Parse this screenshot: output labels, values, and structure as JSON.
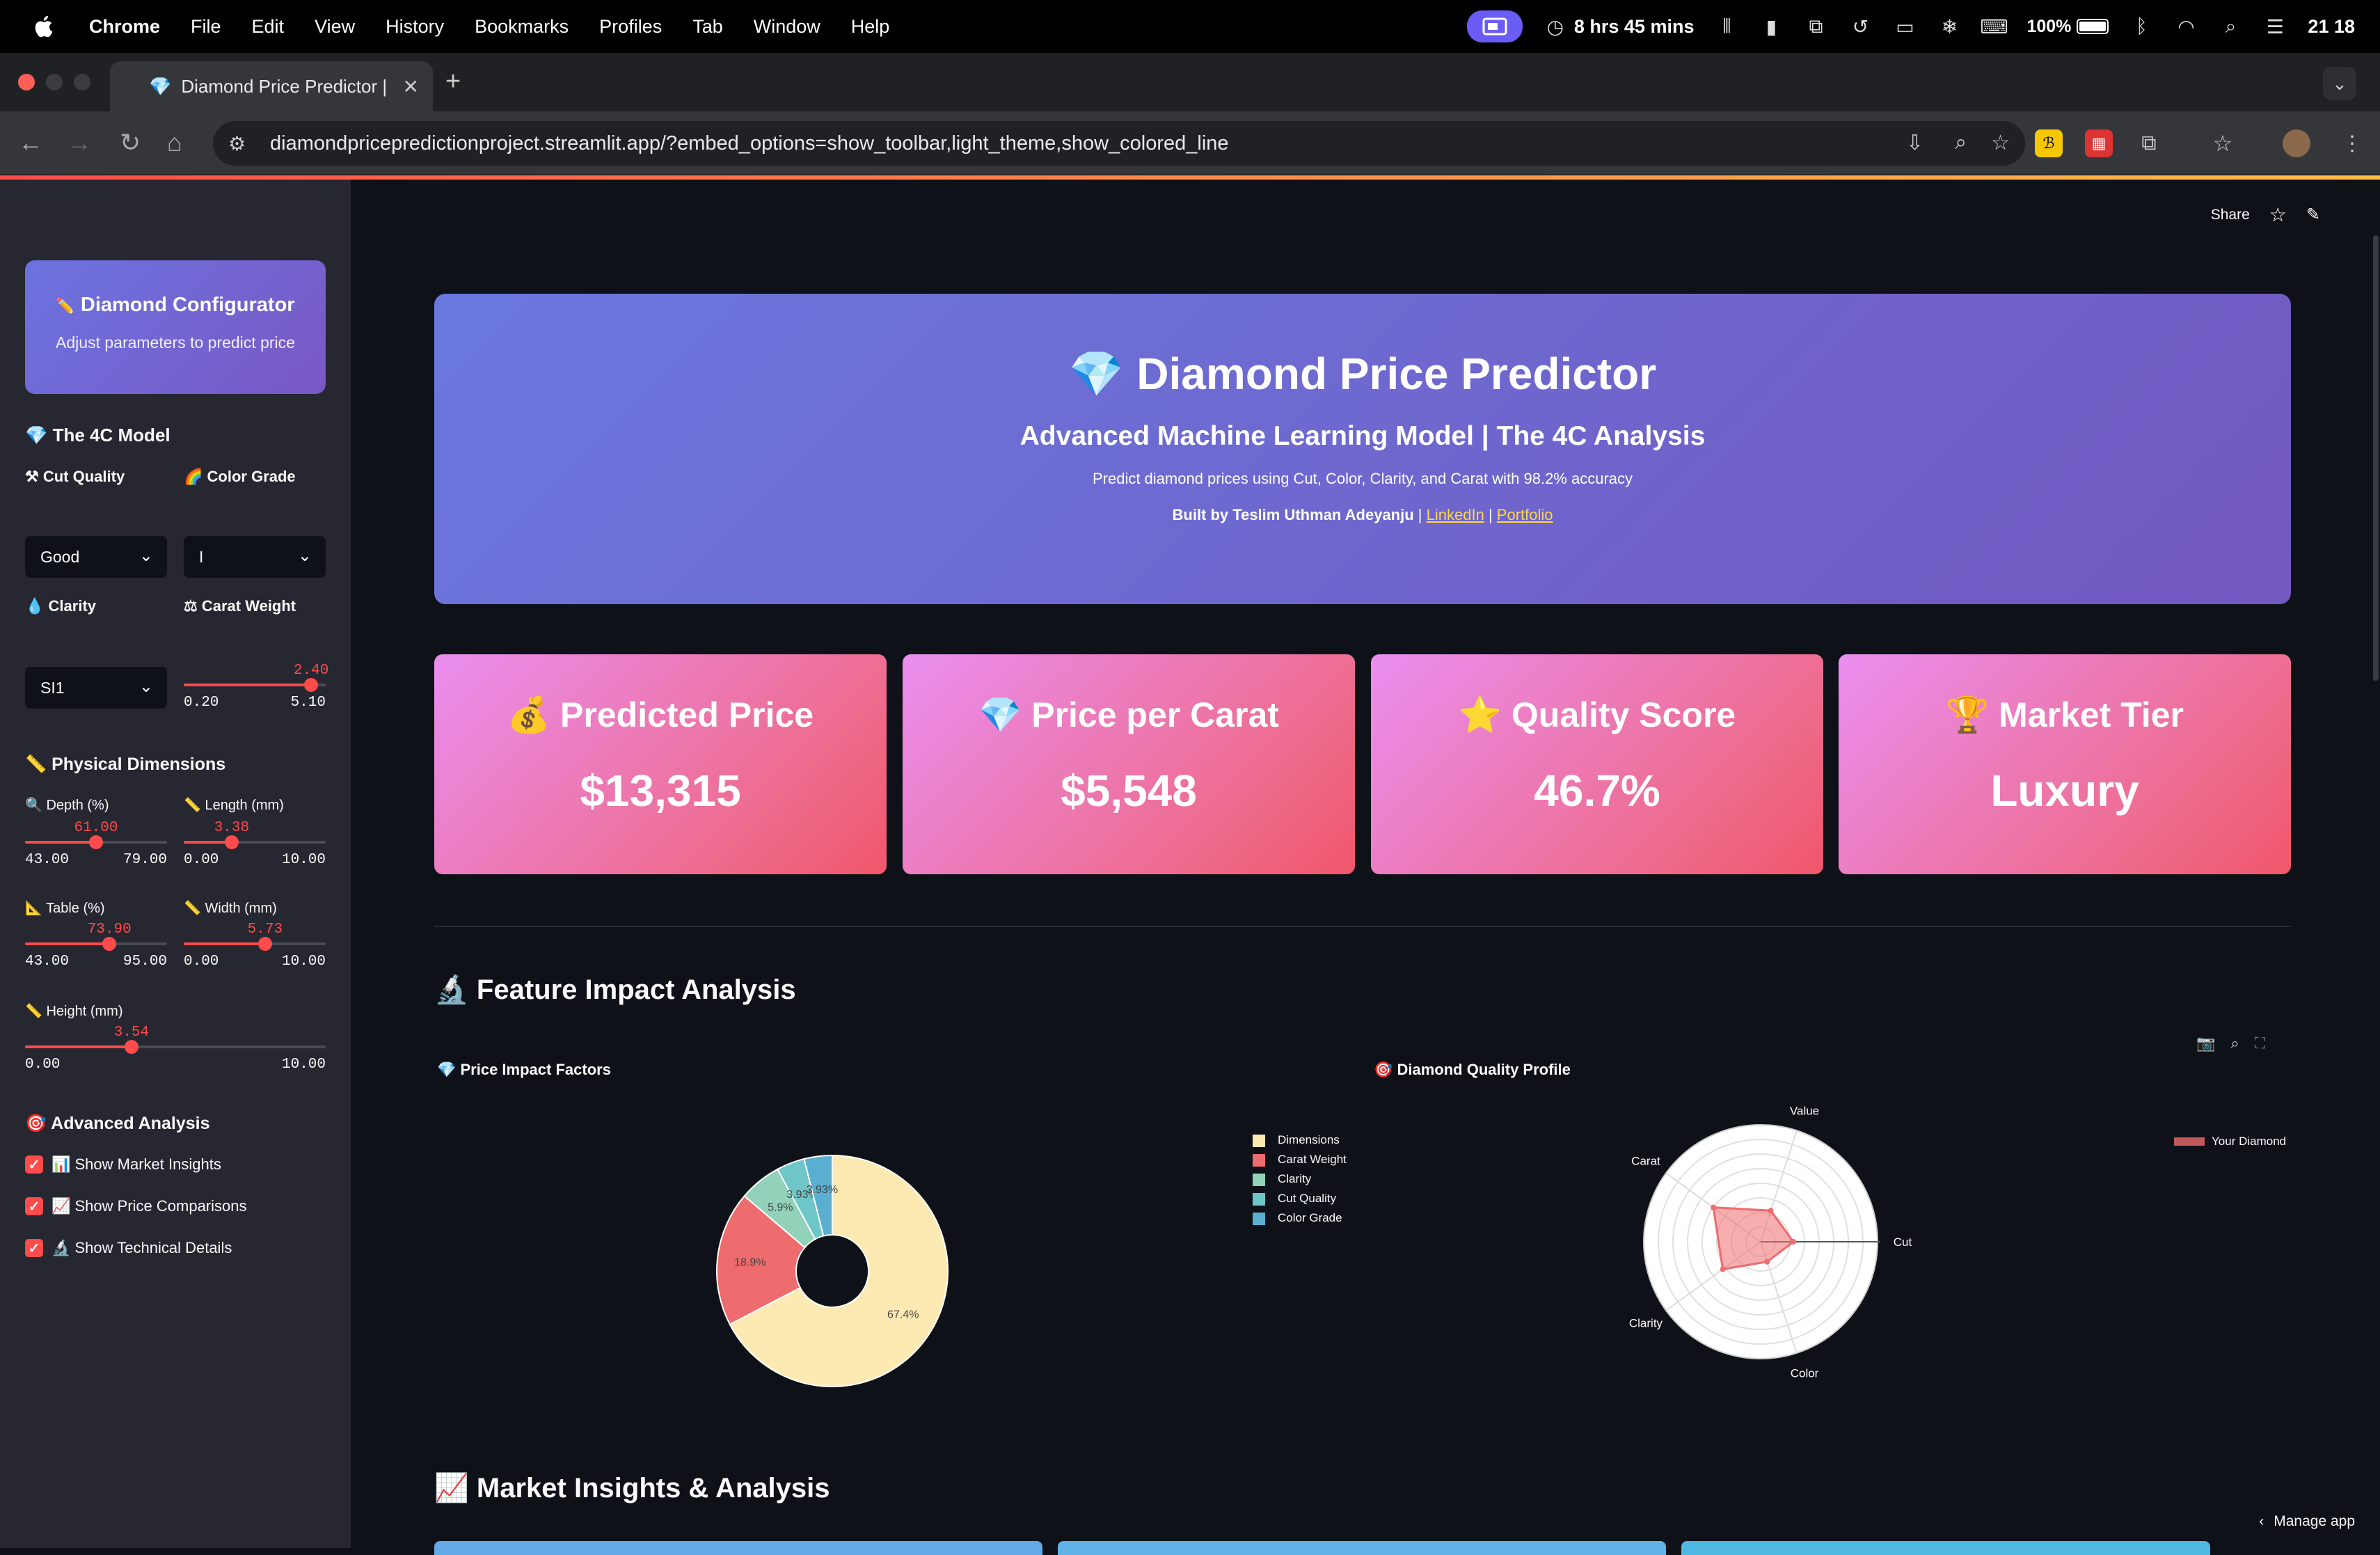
{
  "menubar": {
    "app": "Chrome",
    "items": [
      "File",
      "Edit",
      "View",
      "History",
      "Bookmarks",
      "Profiles",
      "Tab",
      "Window",
      "Help"
    ],
    "timer": "8 hrs 45 mins",
    "battery": "100%",
    "clock": "21 18"
  },
  "browser": {
    "tab_title": "Diamond Price Predictor |",
    "url": "diamondpricepredictionproject.streamlit.app/?embed_options=show_toolbar,light_theme,show_colored_line"
  },
  "sidebar": {
    "config_title": "Diamond Configurator",
    "config_icon": "✏️",
    "config_subtitle": "Adjust parameters to predict price",
    "model_header": "The 4C Model",
    "cut_label": "Cut Quality",
    "color_label": "Color Grade",
    "cut_value": "Good",
    "color_value": "I",
    "clarity_label": "Clarity",
    "carat_label": "Carat Weight",
    "clarity_value": "SI1",
    "carat": {
      "value": "2.40",
      "min": "0.20",
      "max": "5.10",
      "fraction": 0.898
    },
    "dims_header": "Physical Dimensions",
    "depth": {
      "label": "Depth (%)",
      "value": "61.00",
      "min": "43.00",
      "max": "79.00",
      "fraction": 0.5
    },
    "length": {
      "label": "Length (mm)",
      "value": "3.38",
      "min": "0.00",
      "max": "10.00",
      "fraction": 0.338
    },
    "table": {
      "label": "Table (%)",
      "value": "73.90",
      "min": "43.00",
      "max": "95.00",
      "fraction": 0.594
    },
    "width": {
      "label": "Width (mm)",
      "value": "5.73",
      "min": "0.00",
      "max": "10.00",
      "fraction": 0.573
    },
    "height": {
      "label": "Height (mm)",
      "value": "3.54",
      "min": "0.00",
      "max": "10.00",
      "fraction": 0.354
    },
    "advanced_header": "Advanced Analysis",
    "checks": [
      "📊 Show Market Insights",
      "📈 Show Price Comparisons",
      "🔬 Show Technical Details"
    ]
  },
  "main": {
    "share": "Share",
    "hero_title": "💎 Diamond Price Predictor",
    "hero_subtitle": "Advanced Machine Learning Model | The 4C Analysis",
    "hero_desc": "Predict diamond prices using Cut, Color, Clarity, and Carat with 98.2% accuracy",
    "built_by": "Built by Teslim Uthman Adeyanju",
    "sep": "|",
    "linkedin": "LinkedIn",
    "portfolio": "Portfolio",
    "metrics": [
      {
        "title": "💰 Predicted Price",
        "value": "$13,315"
      },
      {
        "title": "💎 Price per Carat",
        "value": "$5,548"
      },
      {
        "title": "⭐ Quality Score",
        "value": "46.7%"
      },
      {
        "title": "🏆 Market Tier",
        "value": "Luxury"
      }
    ],
    "feature_header": "🔬 Feature Impact Analysis",
    "pie_title": "💎 Price Impact Factors",
    "radar_title": "🎯 Diamond Quality Profile",
    "radar_legend": "Your Diamond",
    "market_header": "📈 Market Insights & Analysis",
    "manage_app": "Manage app"
  },
  "chart_data": [
    {
      "type": "pie",
      "title": "💎 Price Impact Factors",
      "categories": [
        "Dimensions",
        "Carat Weight",
        "Clarity",
        "Cut Quality",
        "Color Grade"
      ],
      "values": [
        67.4,
        18.9,
        5.9,
        3.93,
        3.93
      ],
      "labels": [
        "67.4%",
        "18.9%",
        "5.9%",
        "3.93%",
        "3.93%"
      ],
      "colors": [
        "#fdeab2",
        "#ee6b6e",
        "#92d2b8",
        "#6ec6c8",
        "#5aaed0"
      ],
      "hole": true,
      "legend": "right"
    },
    {
      "type": "radar",
      "title": "🎯 Diamond Quality Profile",
      "axes": [
        "Cut",
        "Color",
        "Clarity",
        "Carat",
        "Value"
      ],
      "series": [
        {
          "name": "Your Diamond",
          "values": [
            0.28,
            0.18,
            0.4,
            0.5,
            0.28
          ],
          "color": "#ee6b6e"
        }
      ],
      "legend": "top-right"
    }
  ]
}
